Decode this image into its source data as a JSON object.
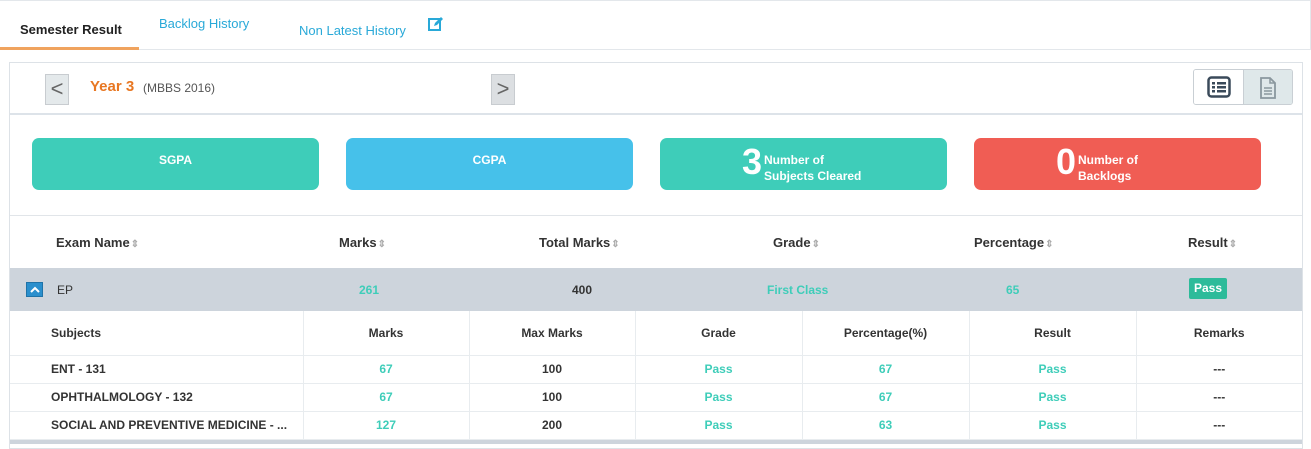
{
  "tabs": {
    "semester_result": "Semester Result",
    "backlog_history": "Backlog History",
    "non_latest_history": "Non Latest History"
  },
  "year_nav": {
    "prev": "<",
    "next": ">",
    "title": "Year 3",
    "subtitle": "(MBBS 2016)"
  },
  "cards": {
    "sgpa": "SGPA",
    "cgpa": "CGPA",
    "cleared_count": "3",
    "cleared_line1": "Number of",
    "cleared_line2": "Subjects Cleared",
    "backlog_count": "0",
    "backlog_line1": "Number of",
    "backlog_line2": "Backlogs"
  },
  "main_headers": {
    "exam_name": "Exam Name",
    "marks": "Marks",
    "total_marks": "Total Marks",
    "grade": "Grade",
    "percentage": "Percentage",
    "result": "Result",
    "sort_glyph": "⇕"
  },
  "exam_row": {
    "name": "EP",
    "marks": "261",
    "total": "400",
    "grade": "First Class",
    "percentage": "65",
    "result": "Pass"
  },
  "subject_headers": {
    "subjects": "Subjects",
    "marks": "Marks",
    "max_marks": "Max Marks",
    "grade": "Grade",
    "percentage": "Percentage(%)",
    "result": "Result",
    "remarks": "Remarks"
  },
  "subjects": [
    {
      "name": "ENT - 131",
      "marks": "67",
      "max": "100",
      "grade": "Pass",
      "percentage": "67",
      "result": "Pass",
      "remarks": "---"
    },
    {
      "name": "OPHTHALMOLOGY - 132",
      "marks": "67",
      "max": "100",
      "grade": "Pass",
      "percentage": "67",
      "result": "Pass",
      "remarks": "---"
    },
    {
      "name": "SOCIAL AND PREVENTIVE MEDICINE - ...",
      "marks": "127",
      "max": "200",
      "grade": "Pass",
      "percentage": "63",
      "result": "Pass",
      "remarks": "---"
    }
  ],
  "colors": {
    "teal": "#3ecdb9",
    "blue": "#46c1ea",
    "red": "#f05d54",
    "orange": "#e87722",
    "link": "#29a9d8"
  }
}
